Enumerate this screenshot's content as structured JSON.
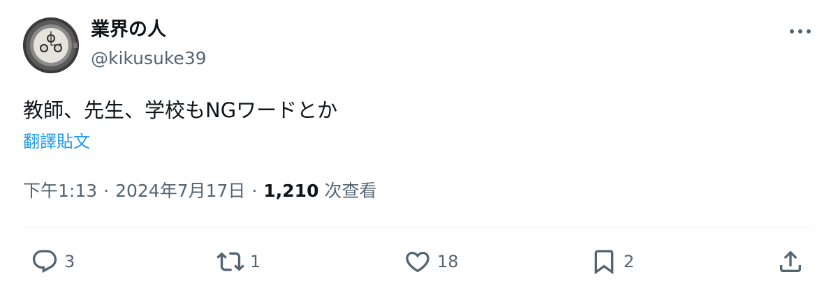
{
  "user": {
    "display_name": "業界の人",
    "handle": "@kikusuke39"
  },
  "tweet": {
    "text": "教師、先生、学校もNGワードとか",
    "translate_label": "翻譯貼文"
  },
  "meta": {
    "time": "下午1:13",
    "separator": "·",
    "date": "2024年7月17日",
    "views_count": "1,210",
    "views_label": "次查看"
  },
  "actions": {
    "reply_count": "3",
    "retweet_count": "1",
    "like_count": "18",
    "bookmark_count": "2"
  },
  "icons": {
    "more": "more-horizontal-icon",
    "reply": "reply-icon",
    "retweet": "retweet-icon",
    "like": "heart-icon",
    "bookmark": "bookmark-icon",
    "share": "share-icon"
  },
  "colors": {
    "text": "#0f1419",
    "secondary": "#536471",
    "link": "#1d9bf0",
    "divider": "#eff3f4"
  }
}
